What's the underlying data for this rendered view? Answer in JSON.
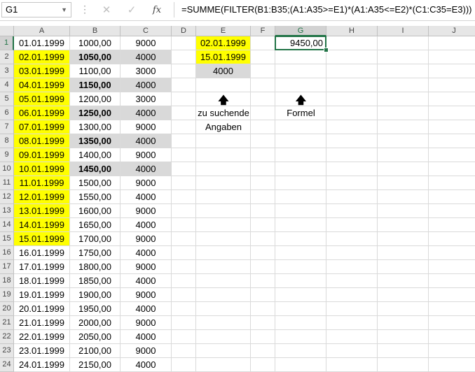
{
  "formula_bar": {
    "name_box": "G1",
    "cancel_icon": "✕",
    "enter_icon": "✓",
    "fx_label": "fx",
    "formula": "=SUMME(FILTER(B1:B35;(A1:A35>=E1)*(A1:A35<=E2)*(C1:C35=E3)))"
  },
  "columns": [
    "A",
    "B",
    "C",
    "D",
    "E",
    "F",
    "G",
    "H",
    "I",
    "J"
  ],
  "selected_column": "G",
  "rows": [
    {
      "n": "1",
      "a": "01.01.1999",
      "b": "1000,00",
      "c": "9000"
    },
    {
      "n": "2",
      "a": "02.01.1999",
      "b": "1050,00",
      "c": "4000"
    },
    {
      "n": "3",
      "a": "03.01.1999",
      "b": "1100,00",
      "c": "3000"
    },
    {
      "n": "4",
      "a": "04.01.1999",
      "b": "1150,00",
      "c": "4000"
    },
    {
      "n": "5",
      "a": "05.01.1999",
      "b": "1200,00",
      "c": "3000"
    },
    {
      "n": "6",
      "a": "06.01.1999",
      "b": "1250,00",
      "c": "4000"
    },
    {
      "n": "7",
      "a": "07.01.1999",
      "b": "1300,00",
      "c": "9000"
    },
    {
      "n": "8",
      "a": "08.01.1999",
      "b": "1350,00",
      "c": "4000"
    },
    {
      "n": "9",
      "a": "09.01.1999",
      "b": "1400,00",
      "c": "9000"
    },
    {
      "n": "10",
      "a": "10.01.1999",
      "b": "1450,00",
      "c": "4000"
    },
    {
      "n": "11",
      "a": "11.01.1999",
      "b": "1500,00",
      "c": "9000"
    },
    {
      "n": "12",
      "a": "12.01.1999",
      "b": "1550,00",
      "c": "4000"
    },
    {
      "n": "13",
      "a": "13.01.1999",
      "b": "1600,00",
      "c": "9000"
    },
    {
      "n": "14",
      "a": "14.01.1999",
      "b": "1650,00",
      "c": "4000"
    },
    {
      "n": "15",
      "a": "15.01.1999",
      "b": "1700,00",
      "c": "9000"
    },
    {
      "n": "16",
      "a": "16.01.1999",
      "b": "1750,00",
      "c": "4000"
    },
    {
      "n": "17",
      "a": "17.01.1999",
      "b": "1800,00",
      "c": "9000"
    },
    {
      "n": "18",
      "a": "18.01.1999",
      "b": "1850,00",
      "c": "4000"
    },
    {
      "n": "19",
      "a": "19.01.1999",
      "b": "1900,00",
      "c": "9000"
    },
    {
      "n": "20",
      "a": "20.01.1999",
      "b": "1950,00",
      "c": "4000"
    },
    {
      "n": "21",
      "a": "21.01.1999",
      "b": "2000,00",
      "c": "9000"
    },
    {
      "n": "22",
      "a": "22.01.1999",
      "b": "2050,00",
      "c": "4000"
    },
    {
      "n": "23",
      "a": "23.01.1999",
      "b": "2100,00",
      "c": "9000"
    },
    {
      "n": "24",
      "a": "24.01.1999",
      "b": "2150,00",
      "c": "4000"
    }
  ],
  "criteria": {
    "e1": "02.01.1999",
    "e2": "15.01.1999",
    "e3": "4000"
  },
  "result": {
    "g1": "9450,00"
  },
  "notes": {
    "arrow": "🡅",
    "criteria_label_line1": "zu suchende",
    "criteria_label_line2": "Angaben",
    "formula_label": "Formel"
  },
  "colors": {
    "highlight_yellow": "#ffff00",
    "match_gray": "#d9d9d9",
    "selection_green": "#217346"
  }
}
